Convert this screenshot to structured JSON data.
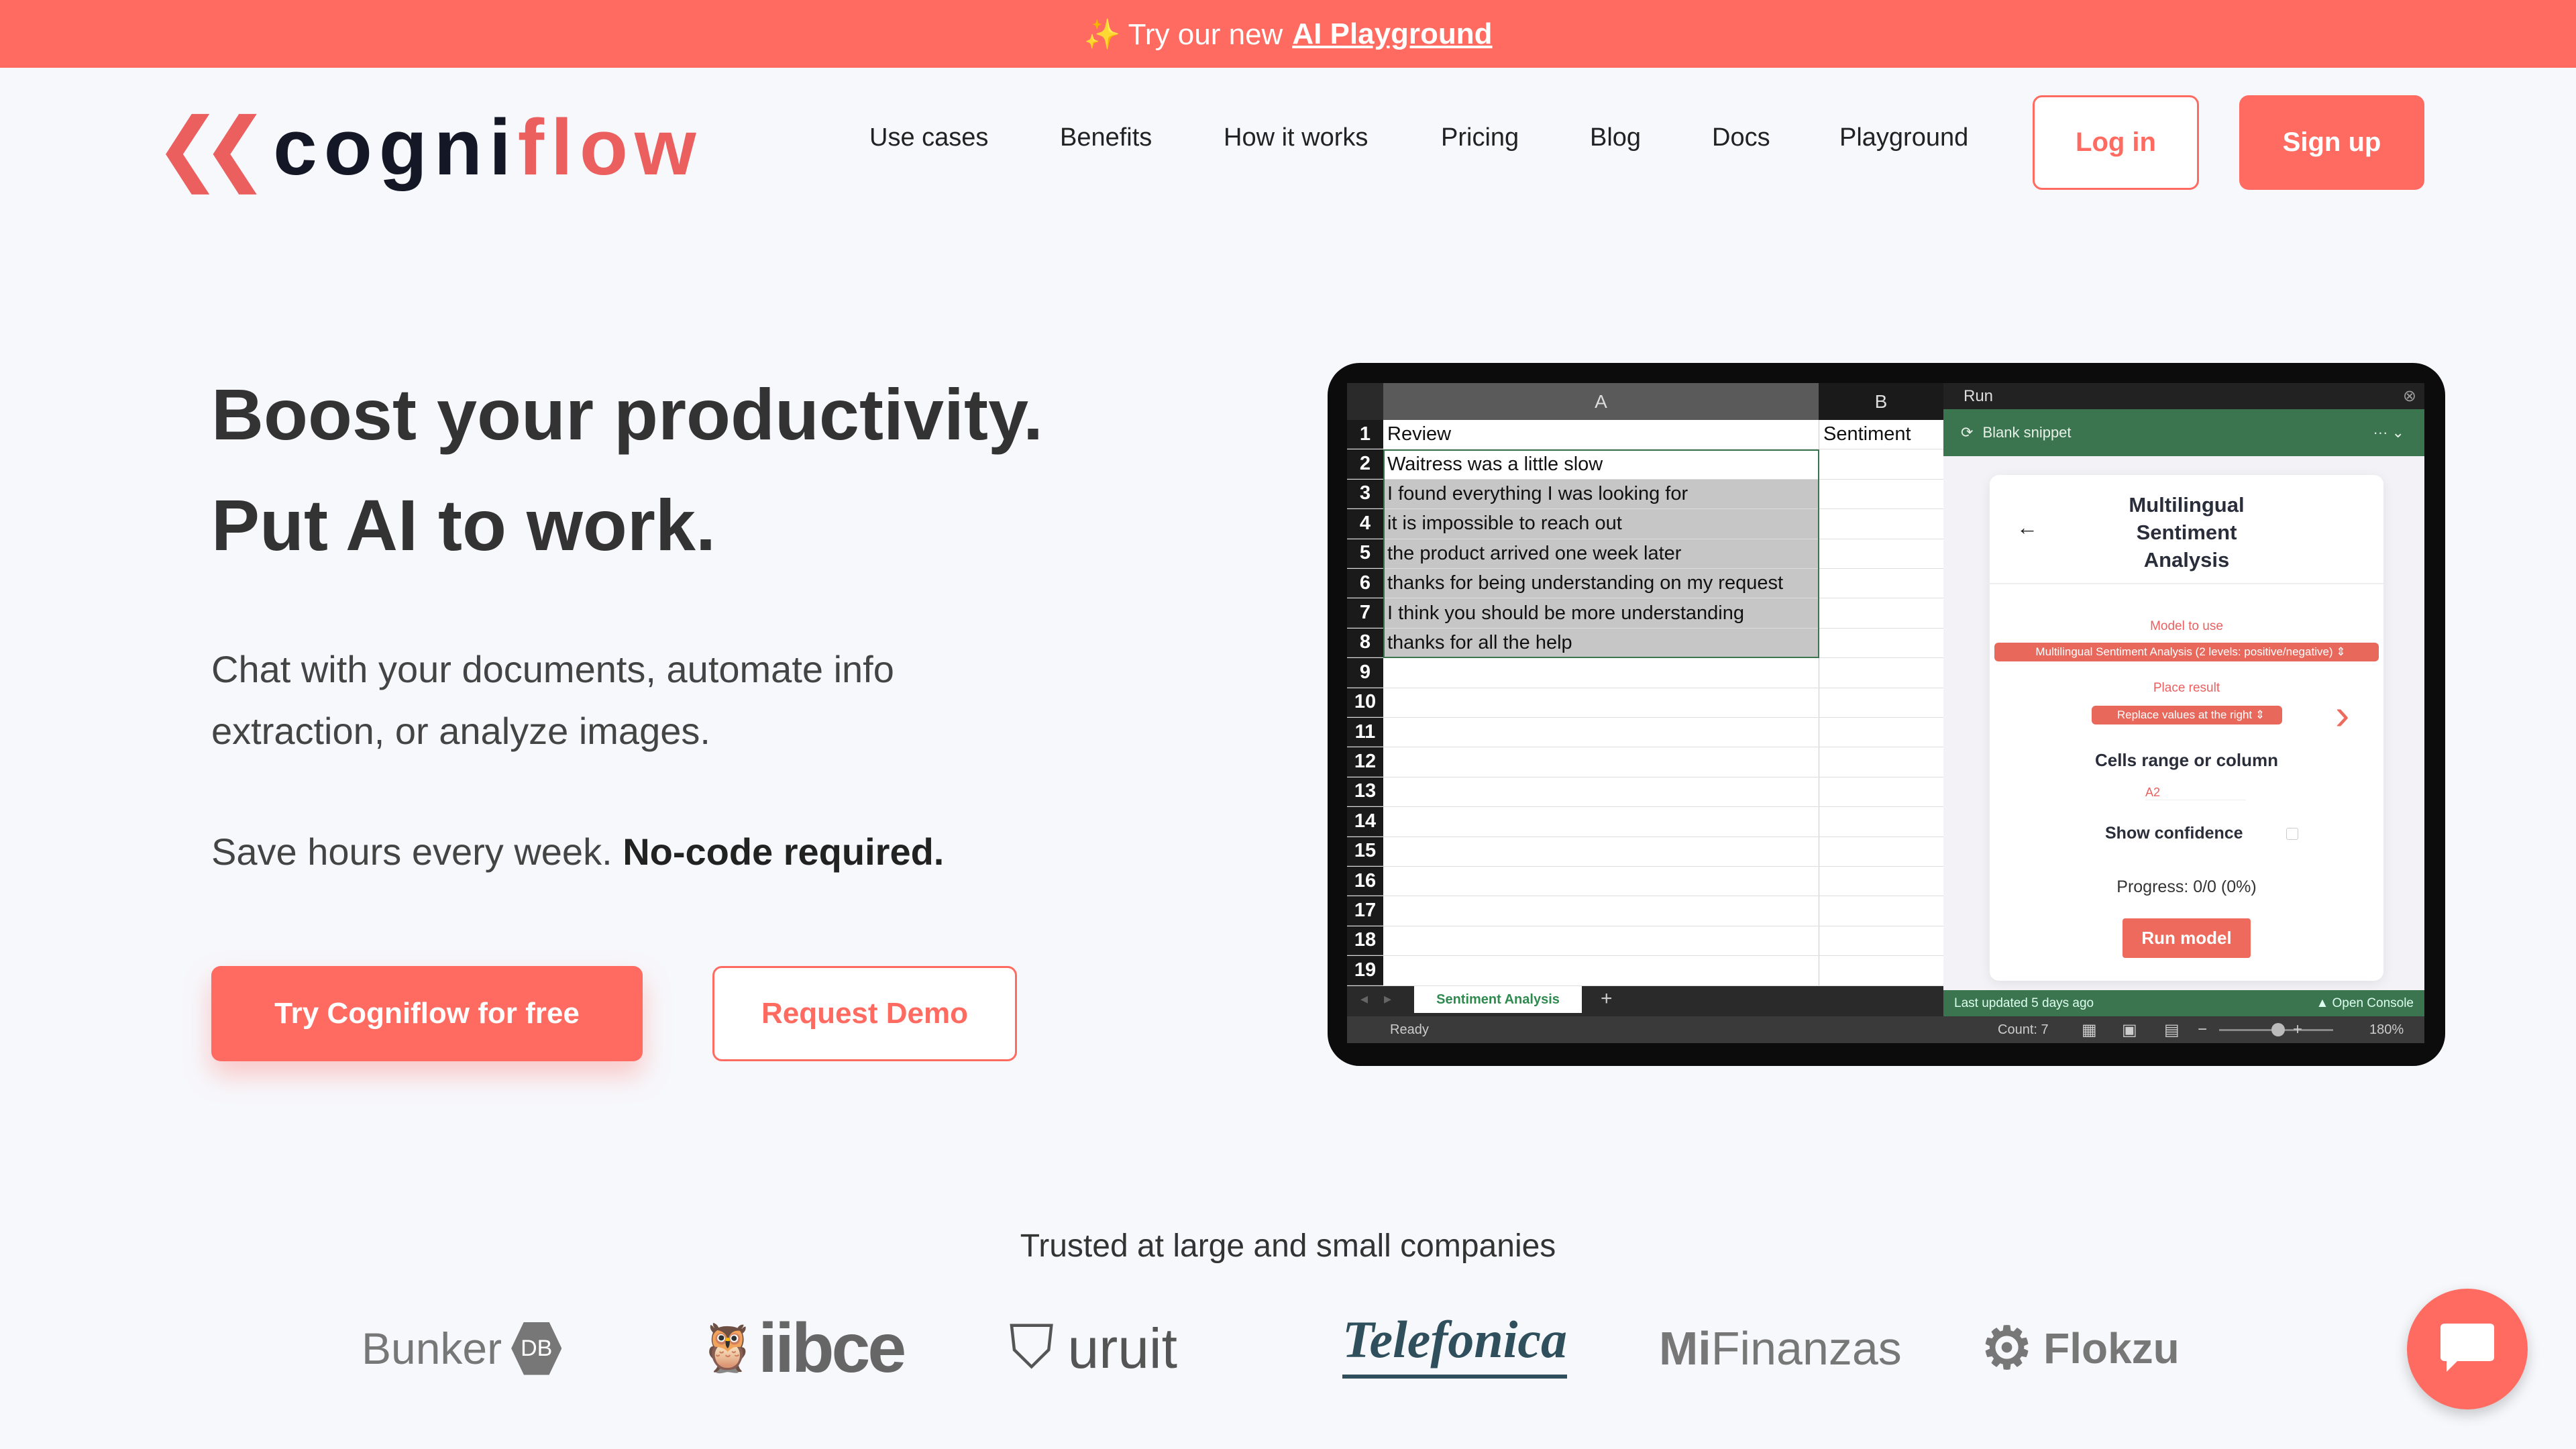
{
  "colors": {
    "brand": "#ff6b61",
    "background": "#f7f8fc",
    "excel_green": "#3a7550"
  },
  "banner": {
    "icon": "sparkles-icon",
    "prefix": "✨ Try our new",
    "link": "AI Playground"
  },
  "logo": {
    "text_dark": "cogni",
    "text_accent": "flow"
  },
  "nav": {
    "items": [
      "Use cases",
      "Benefits",
      "How it works",
      "Pricing",
      "Blog",
      "Docs",
      "Playground"
    ],
    "login": "Log in",
    "signup": "Sign up"
  },
  "hero": {
    "title_line1": "Boost your productivity.",
    "title_line2": "Put AI to work.",
    "desc_line1": "Chat with your documents, automate info",
    "desc_line2": "extraction, or analyze images.",
    "save_text": "Save hours every week.",
    "save_bold": "No-code required.",
    "cta_primary": "Try Cogniflow for free",
    "cta_secondary": "Request Demo"
  },
  "spreadsheet": {
    "col_a": "A",
    "col_b": "B",
    "rows": [
      [
        "Review",
        "Sentiment"
      ],
      [
        "Waitress was a little slow",
        ""
      ],
      [
        "I found everything I was looking for",
        ""
      ],
      [
        "it is impossible to reach out",
        ""
      ],
      [
        "the product arrived one week later",
        ""
      ],
      [
        "thanks for being understanding on my request",
        ""
      ],
      [
        "I think you should be more understanding",
        ""
      ],
      [
        "thanks for all the help",
        ""
      ],
      [
        "",
        ""
      ],
      [
        "",
        ""
      ],
      [
        "",
        ""
      ],
      [
        "",
        ""
      ],
      [
        "",
        ""
      ],
      [
        "",
        ""
      ],
      [
        "",
        ""
      ],
      [
        "",
        ""
      ],
      [
        "",
        ""
      ],
      [
        "",
        ""
      ],
      [
        "",
        ""
      ]
    ],
    "sheet_tab": "Sentiment Analysis",
    "add_sheet": "+",
    "status_ready": "Ready",
    "count": "Count: 7",
    "zoom": "180%"
  },
  "panel": {
    "title": "Run",
    "snippet": "Blank snippet",
    "menu": "··· ⌄",
    "card_title_1": "Multilingual",
    "card_title_2": "Sentiment",
    "card_title_3": "Analysis",
    "back": "←",
    "model_label": "Model to use",
    "model_value": "Multilingual Sentiment Analysis (2 levels: positive/negative)",
    "place_label": "Place result",
    "place_value": "Replace values at the right",
    "range_label": "Cells range or column",
    "range_value": "A2",
    "confidence_label": "Show confidence",
    "confidence_checked": false,
    "progress": "Progress: 0/0 (0%)",
    "run_button": "Run model",
    "last_updated": "Last updated 5 days ago",
    "open_console": "Open Console"
  },
  "trusted": {
    "heading": "Trusted at large and small companies",
    "logos": [
      "Bunker",
      "DB",
      "iibce",
      "uruit",
      "Telefonica",
      "Mi",
      "Finanzas",
      "Flokzu"
    ]
  }
}
